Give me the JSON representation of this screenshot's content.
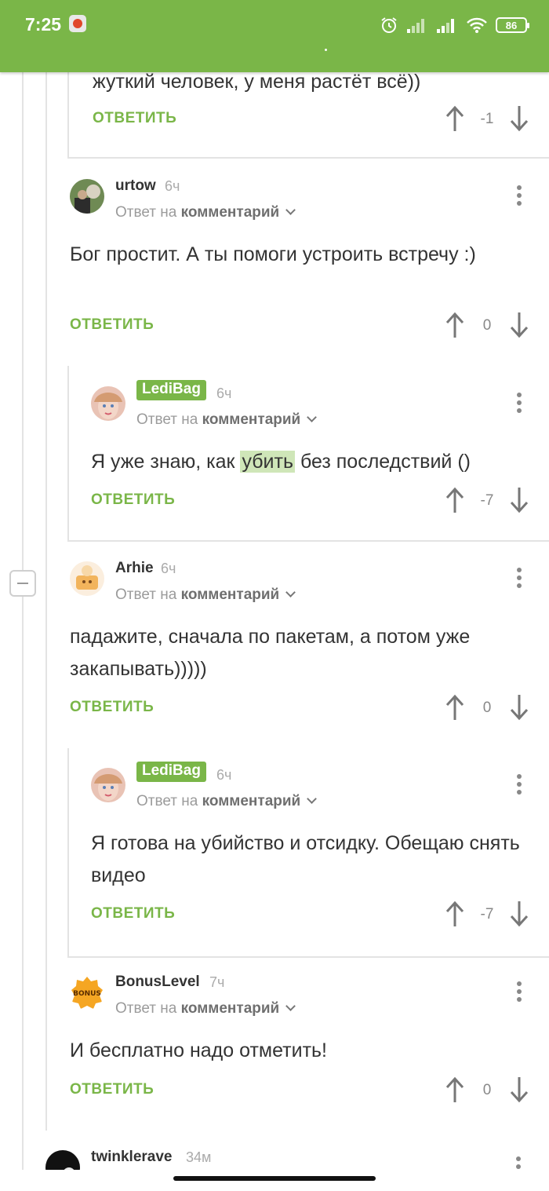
{
  "status_bar": {
    "time": "7:25",
    "battery": "86",
    "accent_color": "#7ab648",
    "icons": [
      "alarm-icon",
      "signal-icon",
      "signal-icon",
      "wifi-icon",
      "battery-icon"
    ]
  },
  "top_partial": {
    "text": "жуткий человек, у меня растёт всё))",
    "reply_label": "ОТВЕТИТЬ",
    "score": "-1"
  },
  "comments": [
    {
      "author": "urtow",
      "time": "6ч",
      "reply_to_prefix": "Ответ на",
      "reply_to_link": "комментарий",
      "body": "Бог простит. А ты помоги устроить встречу :)",
      "reply_label": "ОТВЕТИТЬ",
      "score": "0"
    },
    {
      "author": "LediBag",
      "time": "6ч",
      "reply_to_prefix": "Ответ на",
      "reply_to_link": "комментарий",
      "body_before": "Я уже знаю, как ",
      "body_highlight": "убить",
      "body_after": " без последствий ()",
      "reply_label": "ОТВЕТИТЬ",
      "score": "-7"
    },
    {
      "author": "Arhie",
      "time": "6ч",
      "reply_to_prefix": "Ответ на",
      "reply_to_link": "комментарий",
      "body": "падажите, сначала по пакетам, а потом уже закапывать)))))",
      "reply_label": "ОТВЕТИТЬ",
      "score": "0"
    },
    {
      "author": "LediBag",
      "time": "6ч",
      "reply_to_prefix": "Ответ на",
      "reply_to_link": "комментарий",
      "body": "Я готова на убийство и отсидку. Обещаю снять видео",
      "reply_label": "ОТВЕТИТЬ",
      "score": "-7"
    },
    {
      "author": "BonusLevel",
      "time": "7ч",
      "reply_to_prefix": "Ответ на",
      "reply_to_link": "комментарий",
      "body": "И бесплатно надо отметить!",
      "reply_label": "ОТВЕТИТЬ",
      "score": "0",
      "avatar_text": "BONUS"
    },
    {
      "author": "twinklerave",
      "time": "34м"
    }
  ]
}
